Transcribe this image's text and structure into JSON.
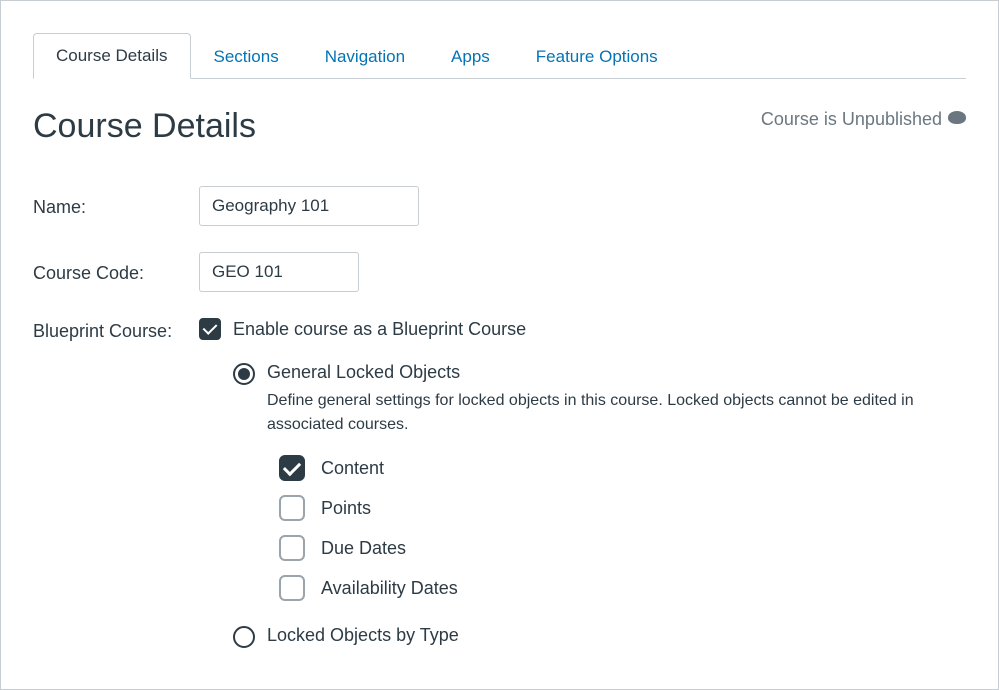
{
  "tabs": {
    "course_details": "Course Details",
    "sections": "Sections",
    "navigation": "Navigation",
    "apps": "Apps",
    "feature_options": "Feature Options"
  },
  "header": {
    "title": "Course Details",
    "status_text": "Course is Unpublished"
  },
  "form": {
    "name_label": "Name:",
    "name_value": "Geography 101",
    "code_label": "Course Code:",
    "code_value": "GEO 101",
    "blueprint_label": "Blueprint Course:",
    "blueprint_checkbox_label": "Enable course as a Blueprint Course",
    "blueprint_checked": true
  },
  "lock_mode": {
    "general": {
      "title": "General Locked Objects",
      "description": "Define general settings for locked objects in this course. Locked objects cannot be edited in associated courses.",
      "selected": true,
      "options": [
        {
          "label": "Content",
          "checked": true
        },
        {
          "label": "Points",
          "checked": false
        },
        {
          "label": "Due Dates",
          "checked": false
        },
        {
          "label": "Availability Dates",
          "checked": false
        }
      ]
    },
    "by_type": {
      "title": "Locked Objects by Type",
      "selected": false
    }
  }
}
